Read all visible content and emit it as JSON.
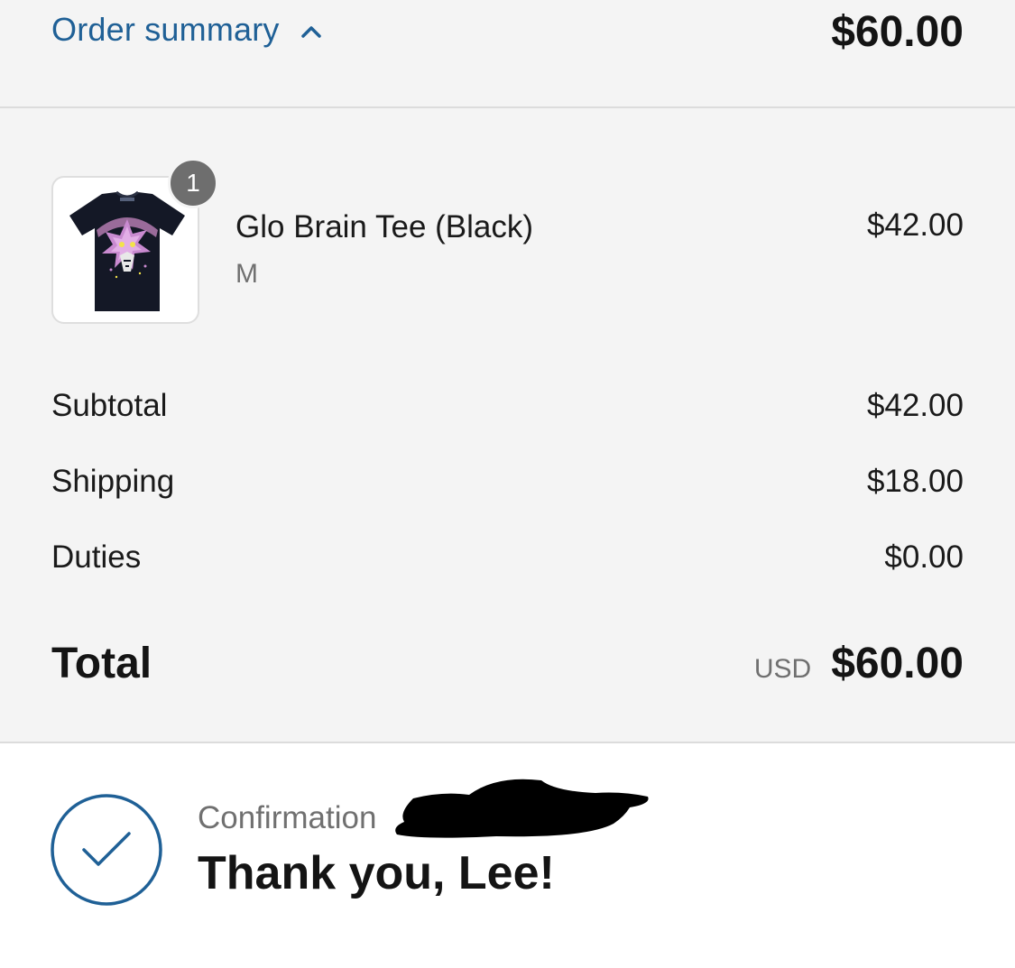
{
  "header": {
    "toggle_label": "Order summary",
    "total": "$60.00"
  },
  "line_items": [
    {
      "quantity": "1",
      "name": "Glo Brain Tee (Black)",
      "variant": "M",
      "price": "$42.00"
    }
  ],
  "totals": {
    "subtotal_label": "Subtotal",
    "subtotal_value": "$42.00",
    "shipping_label": "Shipping",
    "shipping_value": "$18.00",
    "duties_label": "Duties",
    "duties_value": "$0.00",
    "total_label": "Total",
    "currency": "USD",
    "total_value": "$60.00"
  },
  "confirmation": {
    "label": "Confirmation",
    "thanks": "Thank you, Lee!"
  },
  "icons": {
    "toggle": "chevron-up-icon",
    "status": "check-circle-icon"
  },
  "colors": {
    "accent": "#1f6096",
    "panel_bg": "#f4f4f4",
    "badge": "#6e6e6e"
  }
}
